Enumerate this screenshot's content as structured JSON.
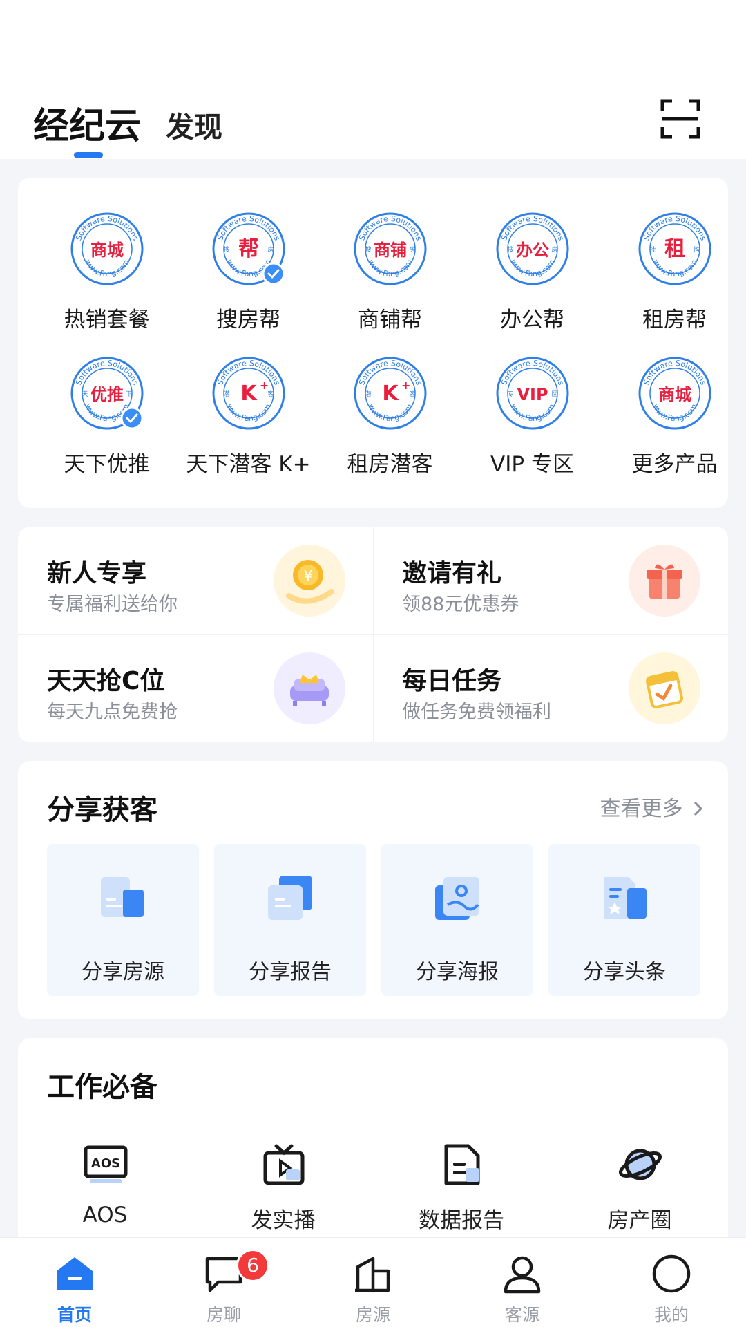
{
  "header": {
    "tab_main": "经纪云",
    "tab_second": "发现"
  },
  "products": [
    {
      "label": "热销套餐",
      "seal": "商城",
      "left": "",
      "right": "",
      "verified": false
    },
    {
      "label": "搜房帮",
      "seal": "帮",
      "left": "搜",
      "right": "房",
      "verified": true
    },
    {
      "label": "商铺帮",
      "seal": "商铺",
      "left": "搜",
      "right": "房",
      "verified": false
    },
    {
      "label": "办公帮",
      "seal": "办公",
      "left": "搜",
      "right": "房",
      "verified": false
    },
    {
      "label": "租房帮",
      "seal": "租",
      "left": "挂",
      "right": "牌",
      "verified": false
    },
    {
      "label": "天下优推",
      "seal": "优推",
      "left": "天",
      "right": "下",
      "verified": true
    },
    {
      "label": "天下潜客 K+",
      "seal": "K",
      "left": "潜",
      "right": "客",
      "verified": false
    },
    {
      "label": "租房潜客",
      "seal": "K",
      "left": "潜",
      "right": "客",
      "verified": false
    },
    {
      "label": "VIP 专区",
      "seal": "VIP",
      "left": "专",
      "right": "区",
      "verified": false
    },
    {
      "label": "更多产品",
      "seal": "商城",
      "left": "",
      "right": "",
      "verified": false
    }
  ],
  "seal_text": {
    "top": "Software Solutions",
    "bottom": "www.Fang.com"
  },
  "promos": [
    {
      "title": "新人专享",
      "subtitle": "专属福利送给你",
      "icon": "coin-hand-icon"
    },
    {
      "title": "邀请有礼",
      "subtitle": "领88元优惠券",
      "icon": "gift-icon"
    },
    {
      "title": "天天抢C位",
      "subtitle": "每天九点免费抢",
      "icon": "crown-sofa-icon"
    },
    {
      "title": "每日任务",
      "subtitle": "做任务免费领福利",
      "icon": "calendar-check-icon"
    }
  ],
  "share": {
    "title": "分享获客",
    "more": "查看更多",
    "items": [
      {
        "label": "分享房源",
        "icon": "share-listing-icon"
      },
      {
        "label": "分享报告",
        "icon": "share-report-icon"
      },
      {
        "label": "分享海报",
        "icon": "share-poster-icon"
      },
      {
        "label": "分享头条",
        "icon": "share-headline-icon"
      }
    ]
  },
  "work": {
    "title": "工作必备",
    "items": [
      {
        "label": "AOS",
        "icon": "aos-icon"
      },
      {
        "label": "发实播",
        "icon": "live-tv-icon"
      },
      {
        "label": "数据报告",
        "icon": "document-icon"
      },
      {
        "label": "房产圈",
        "icon": "planet-icon"
      }
    ]
  },
  "nav": {
    "items": [
      {
        "label": "首页",
        "icon": "home-icon",
        "active": true
      },
      {
        "label": "房聊",
        "icon": "chat-icon",
        "active": false
      },
      {
        "label": "房源",
        "icon": "building-icon",
        "active": false
      },
      {
        "label": "客源",
        "icon": "person-icon",
        "active": false
      },
      {
        "label": "我的",
        "icon": "profile-circle-icon",
        "active": false
      }
    ],
    "chat_badge": "6"
  },
  "colors": {
    "accent": "#2478f2",
    "seal_red": "#e8203f",
    "badge": "#f23a3a"
  }
}
